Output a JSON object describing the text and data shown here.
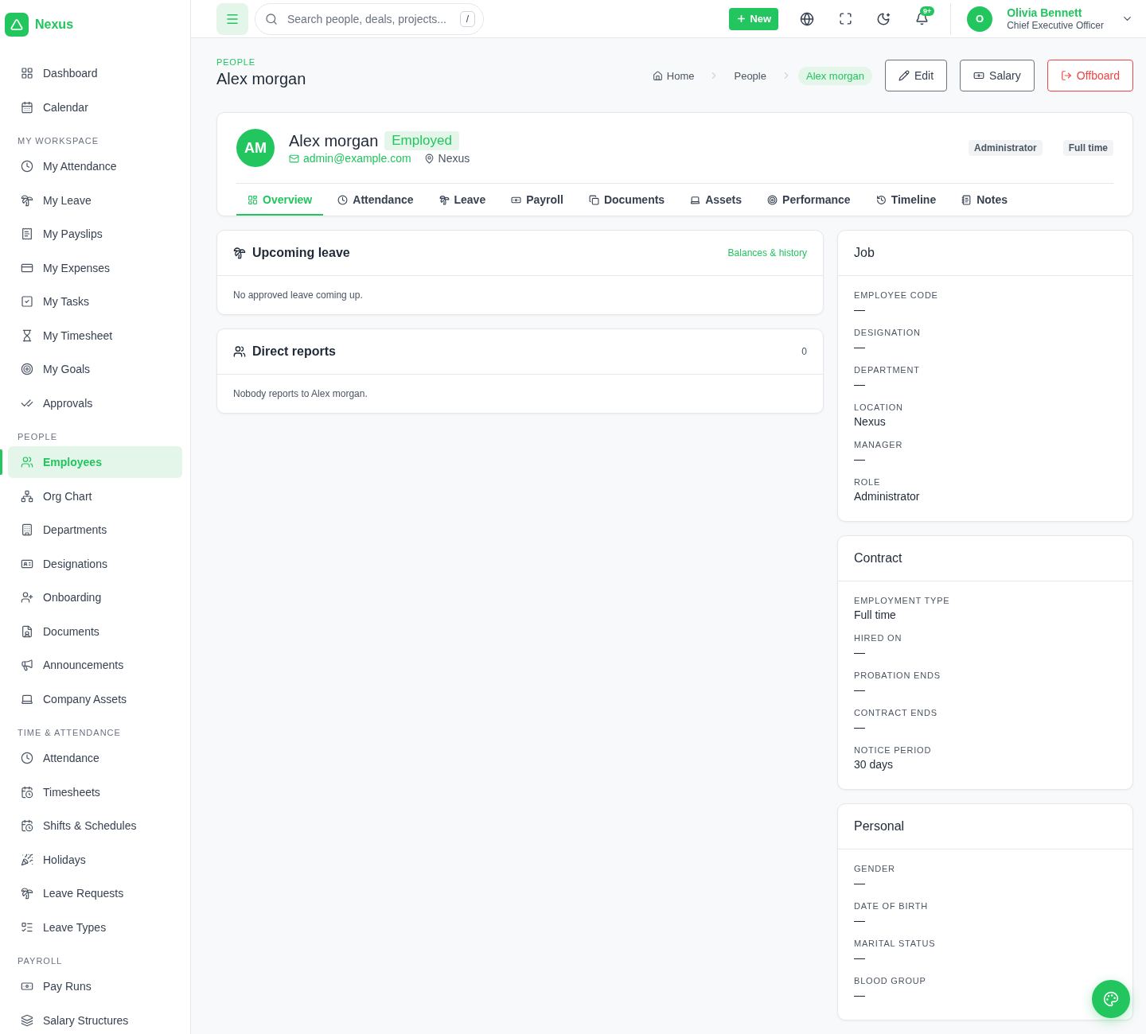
{
  "sidebar": {
    "brand": "Nexus",
    "sections": [
      {
        "items": [
          {
            "label": "Dashboard",
            "selected": false
          },
          {
            "label": "Calendar",
            "selected": false
          }
        ]
      },
      {
        "title": "MY WORKSPACE",
        "items": [
          {
            "label": "My Attendance",
            "selected": false
          },
          {
            "label": "My Leave",
            "selected": false
          },
          {
            "label": "My Payslips",
            "selected": false
          },
          {
            "label": "My Expenses",
            "selected": false
          },
          {
            "label": "My Tasks",
            "selected": false
          },
          {
            "label": "My Timesheet",
            "selected": false
          },
          {
            "label": "My Goals",
            "selected": false
          },
          {
            "label": "Approvals",
            "selected": false
          }
        ]
      },
      {
        "title": "PEOPLE",
        "items": [
          {
            "label": "Employees",
            "selected": true
          },
          {
            "label": "Org Chart",
            "selected": false
          },
          {
            "label": "Departments",
            "selected": false
          },
          {
            "label": "Designations",
            "selected": false
          },
          {
            "label": "Onboarding",
            "selected": false
          },
          {
            "label": "Documents",
            "selected": false
          },
          {
            "label": "Announcements",
            "selected": false
          },
          {
            "label": "Company Assets",
            "selected": false
          }
        ]
      },
      {
        "title": "TIME & ATTENDANCE",
        "items": [
          {
            "label": "Attendance",
            "selected": false
          },
          {
            "label": "Timesheets",
            "selected": false
          },
          {
            "label": "Shifts & Schedules",
            "selected": false
          },
          {
            "label": "Holidays",
            "selected": false
          },
          {
            "label": "Leave Requests",
            "selected": false
          },
          {
            "label": "Leave Types",
            "selected": false
          }
        ]
      },
      {
        "title": "PAYROLL",
        "items": [
          {
            "label": "Pay Runs",
            "selected": false
          },
          {
            "label": "Salary Structures",
            "selected": false
          }
        ]
      }
    ]
  },
  "topbar": {
    "search": {
      "placeholder": "Search people, deals, projects...",
      "shortcut": "/"
    },
    "new_button": "New",
    "notification_badge": "9+",
    "user": {
      "initial": "O",
      "name": "Olivia Bennett",
      "role": "Chief Executive Officer"
    }
  },
  "header": {
    "eyebrow": "PEOPLE",
    "title": "Alex morgan",
    "breadcrumbs": [
      {
        "label": "Home",
        "selected": false
      },
      {
        "label": "People",
        "selected": false
      },
      {
        "label": "Alex morgan",
        "selected": true
      }
    ],
    "actions": [
      {
        "label": "Edit",
        "kind": "default"
      },
      {
        "label": "Salary",
        "kind": "default"
      },
      {
        "label": "Offboard",
        "kind": "danger"
      }
    ]
  },
  "profile": {
    "initials": "AM",
    "name": "Alex morgan",
    "status": "Employed",
    "email": "admin@example.com",
    "location": "Nexus",
    "tags": [
      "Administrator",
      "Full time"
    ],
    "tabs": [
      {
        "label": "Overview",
        "selected": true
      },
      {
        "label": "Attendance",
        "selected": false
      },
      {
        "label": "Leave",
        "selected": false
      },
      {
        "label": "Payroll",
        "selected": false
      },
      {
        "label": "Documents",
        "selected": false
      },
      {
        "label": "Assets",
        "selected": false
      },
      {
        "label": "Performance",
        "selected": false
      },
      {
        "label": "Timeline",
        "selected": false
      },
      {
        "label": "Notes",
        "selected": false
      }
    ]
  },
  "upcoming_leave": {
    "title": "Upcoming leave",
    "link": "Balances & history",
    "message": "No approved leave coming up."
  },
  "direct_reports": {
    "title": "Direct reports",
    "count": "0",
    "message": "Nobody reports to Alex morgan."
  },
  "info_cards": [
    {
      "title": "Job",
      "fields": [
        {
          "label": "EMPLOYEE CODE",
          "value": "—"
        },
        {
          "label": "DESIGNATION",
          "value": "—"
        },
        {
          "label": "DEPARTMENT",
          "value": "—"
        },
        {
          "label": "LOCATION",
          "value": "Nexus"
        },
        {
          "label": "MANAGER",
          "value": "—"
        },
        {
          "label": "ROLE",
          "value": "Administrator"
        }
      ]
    },
    {
      "title": "Contract",
      "fields": [
        {
          "label": "EMPLOYMENT TYPE",
          "value": "Full time"
        },
        {
          "label": "HIRED ON",
          "value": "—"
        },
        {
          "label": "PROBATION ENDS",
          "value": "—"
        },
        {
          "label": "CONTRACT ENDS",
          "value": "—"
        },
        {
          "label": "NOTICE PERIOD",
          "value": "30 days"
        }
      ]
    },
    {
      "title": "Personal",
      "fields": [
        {
          "label": "GENDER",
          "value": "—"
        },
        {
          "label": "DATE OF BIRTH",
          "value": "—"
        },
        {
          "label": "MARITAL STATUS",
          "value": "—"
        },
        {
          "label": "BLOOD GROUP",
          "value": "—"
        }
      ]
    }
  ]
}
